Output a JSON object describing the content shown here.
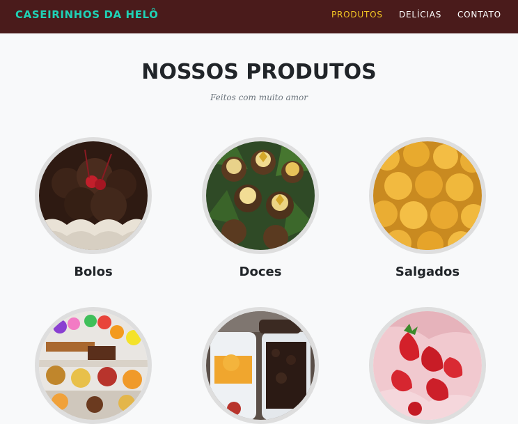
{
  "brand": "CASEIRINHOS DA HELÔ",
  "nav": [
    {
      "label": "PRODUTOS",
      "active": true
    },
    {
      "label": "DELÍCIAS",
      "active": false
    },
    {
      "label": "CONTATO",
      "active": false
    }
  ],
  "section": {
    "title": "NOSSOS PRODUTOS",
    "subtitle": "Feitos com muito amor"
  },
  "products": [
    {
      "name": "Bolos",
      "image": "chocolate-cake-photo"
    },
    {
      "name": "Doces",
      "image": "candies-photo"
    },
    {
      "name": "Salgados",
      "image": "savory-snacks-photo"
    },
    {
      "name": "",
      "image": "party-table-photo"
    },
    {
      "name": "",
      "image": "pots-desserts-photo"
    },
    {
      "name": "",
      "image": "strawberry-dessert-photo"
    }
  ],
  "colors": {
    "navbar": "#4a1b1b",
    "brand": "#1fd1b5",
    "active_link": "#f3c623",
    "background": "#f8f9fa"
  }
}
